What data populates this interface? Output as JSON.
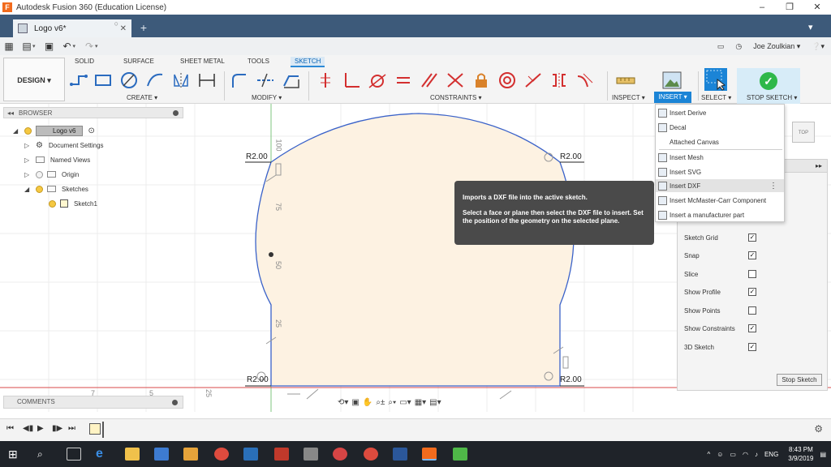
{
  "window": {
    "title": "Autodesk Fusion 360 (Education License)",
    "logo_letter": "F"
  },
  "tab": {
    "name": "Logo v6*"
  },
  "user": {
    "name": "Joe Zoulkian ▾"
  },
  "ribbon": {
    "design_button": "DESIGN ▾",
    "tabs": [
      "SOLID",
      "SURFACE",
      "SHEET METAL",
      "TOOLS",
      "SKETCH"
    ],
    "groups": {
      "create": "CREATE ▾",
      "modify": "MODIFY ▾",
      "constraints": "CONSTRAINTS ▾",
      "inspect": "INSPECT ▾",
      "insert": "INSERT ▾",
      "select": "SELECT ▾",
      "stop_sketch": "STOP SKETCH ▾"
    }
  },
  "browser": {
    "title": "BROWSER",
    "nodes": [
      "Logo v6",
      "Document Settings",
      "Named Views",
      "Origin",
      "Sketches",
      "Sketch1"
    ]
  },
  "comments": {
    "title": "COMMENTS"
  },
  "insert_menu": {
    "items": [
      "Insert Derive",
      "Decal",
      "Attached Canvas",
      "Insert Mesh",
      "Insert SVG",
      "Insert DXF",
      "Insert McMaster-Carr Component",
      "Insert a manufacturer part"
    ],
    "highlighted": "Insert DXF",
    "more_icon": "⋮"
  },
  "tooltip": {
    "line1": "Imports a DXF file into the active sketch.",
    "line2": "Select a face or plane then select the DXF file to insert. Set the position of the geometry on the selected plane."
  },
  "palette": {
    "options": [
      {
        "label": "Sketch Grid",
        "checked": true
      },
      {
        "label": "Snap",
        "checked": true
      },
      {
        "label": "Slice",
        "checked": false
      },
      {
        "label": "Show Profile",
        "checked": true
      },
      {
        "label": "Show Points",
        "checked": false
      },
      {
        "label": "Show Constraints",
        "checked": true
      },
      {
        "label": "3D Sketch",
        "checked": true
      }
    ],
    "stop_button": "Stop Sketch"
  },
  "canvas": {
    "dims": [
      "R2.00",
      "R2.00",
      "R2.00",
      "R2.00"
    ],
    "ruler_vertical": [
      "100",
      "75",
      "50",
      "25"
    ],
    "ruler_horizontal": [
      "7",
      "5",
      "25"
    ]
  },
  "viewcube": {
    "label": "TOP"
  },
  "tray": {
    "lang": "ENG",
    "time": "8:43 PM",
    "date": "3/9/2019"
  },
  "colors": {
    "accent": "#1b84d6",
    "sketch_line": "#3a62c9",
    "profile_fill": "#fdf2e2",
    "tab_bar": "#3d5a7a",
    "taskbar": "#1f2329"
  }
}
